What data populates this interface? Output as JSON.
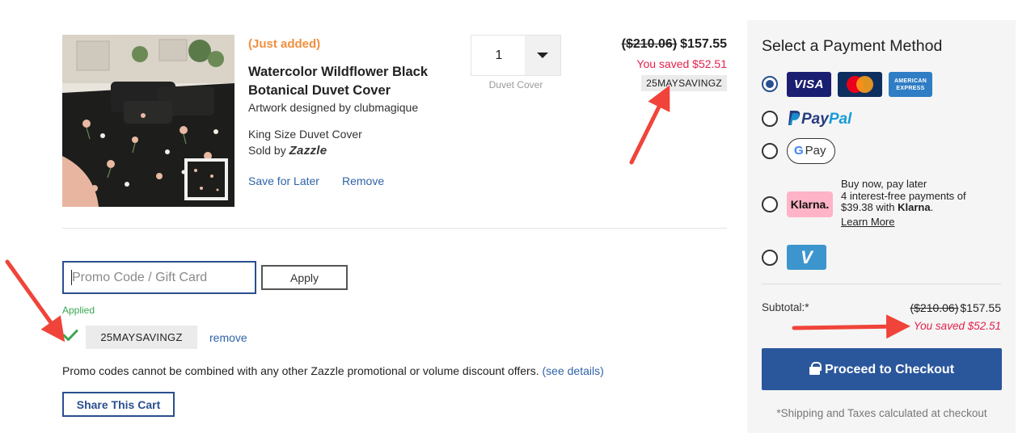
{
  "product": {
    "status": "(Just added)",
    "title": "Watercolor Wildflower Black Botanical Duvet Cover",
    "artist": "Artwork designed by clubmagique",
    "size": "King Size Duvet Cover",
    "sold_by_prefix": "Sold by",
    "sold_by_brand": "Zazzle",
    "save_for_later": "Save for Later",
    "remove": "Remove",
    "quantity": "1",
    "quantity_label": "Duvet Cover",
    "original_price": "($210.06)",
    "price": "$157.55",
    "saved": "You saved $52.51",
    "applied_code": "25MAYSAVINGZ"
  },
  "promo": {
    "placeholder": "Promo Code / Gift Card",
    "apply": "Apply",
    "status": "Applied",
    "code": "25MAYSAVINGZ",
    "remove": "remove",
    "note": "Promo codes cannot be combined with any other Zazzle promotional or volume discount offers.",
    "details_link": "(see details)",
    "share": "Share This Cart"
  },
  "payment": {
    "title": "Select a Payment Method",
    "selected": "cards",
    "cards": {
      "visa": "VISA",
      "amex": "AMERICAN EXPRESS"
    },
    "paypal": {
      "p": "Pay",
      "pal": "Pal"
    },
    "gpay": {
      "g": "G",
      "pay": "Pay"
    },
    "klarna": {
      "logo": "Klarna.",
      "line1": "Buy now, pay later",
      "line2": "4 interest-free payments of",
      "line3": "$39.38 with",
      "line3_brand": "Klarna",
      "learn_more": "Learn More"
    },
    "venmo": "V",
    "subtotal_label": "Subtotal:*",
    "subtotal_original": "($210.06)",
    "subtotal": "$157.55",
    "subtotal_saved": "You saved $52.51",
    "checkout": "Proceed to Checkout",
    "shipping_note": "*Shipping and Taxes calculated at checkout"
  },
  "colors": {
    "accent_blue": "#2a579c",
    "just_added_orange": "#f08f3e",
    "saved_red": "#e3204b",
    "applied_green": "#3aa64f",
    "annotation_arrow": "#f0443a"
  }
}
